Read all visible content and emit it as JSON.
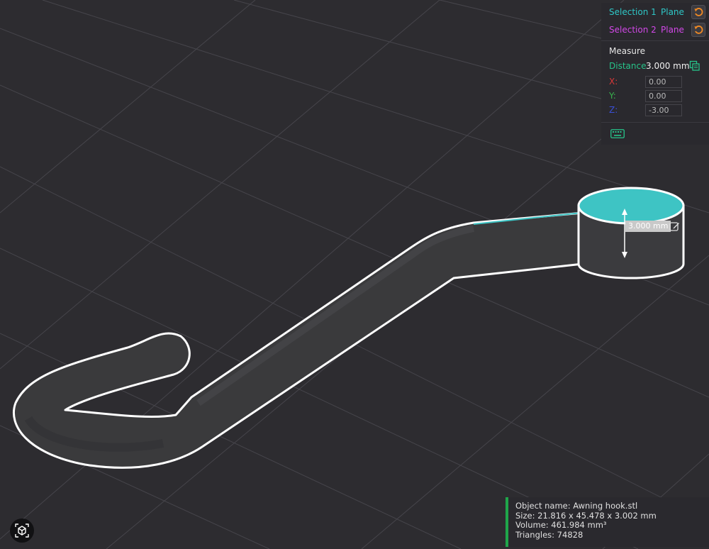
{
  "selections": [
    {
      "label": "Selection 1",
      "type": "Plane",
      "color": "#2ec7c7"
    },
    {
      "label": "Selection 2",
      "type": "Plane",
      "color": "#d248e8"
    }
  ],
  "measure": {
    "title": "Measure",
    "distance_label": "Distance",
    "distance_value": "3.000 mm",
    "axes": [
      {
        "label": "X:",
        "value": "0.00",
        "color": "#d83838"
      },
      {
        "label": "Y:",
        "value": "0.00",
        "color": "#37b24d"
      },
      {
        "label": "Z:",
        "value": "-3.00",
        "color": "#3a4fd6"
      }
    ]
  },
  "dimension_label": "3.000 mm",
  "object_info": {
    "name": "Object name: Awning hook.stl",
    "size": "Size: 21.816 x 45.478 x 3.002 mm",
    "volume": "Volume: 461.984 mm³",
    "triangles": "Triangles: 74828"
  },
  "colors": {
    "accent_green": "#27c48a",
    "reset_orange": "#f08a24",
    "selected_face": "#3ec4c4",
    "info_border": "#1fa64a"
  },
  "icons": {
    "reset": "reset-icon",
    "copy": "copy-icon",
    "keyboard": "keyboard-icon",
    "edit": "edit-icon",
    "view": "view-cube-icon"
  }
}
